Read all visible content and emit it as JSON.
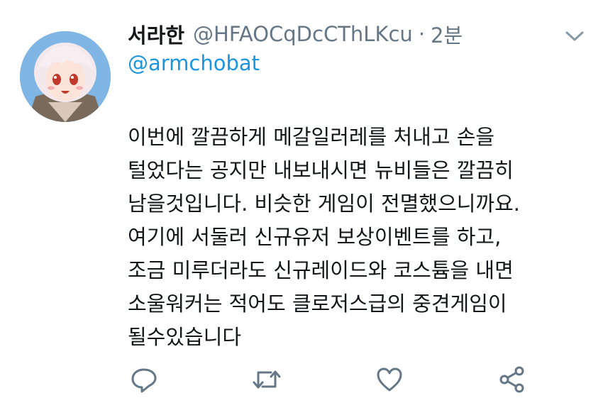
{
  "tweet": {
    "author_name": "서라한",
    "author_handle": "@HFAOCqDcCThLKcu",
    "separator": "·",
    "time": "2분",
    "reply_to": "@armchobat",
    "text_lines": [
      "이번에 깔끔하게 메갈일러레를 처내고 손을",
      "털었다는 공지만 내보내시면 뉴비들은 깔끔히",
      "남을것입니다. 비슷한 게임이 전멸했으니까요.",
      "여기에 서둘러 신규유저 보상이벤트를 하고,",
      "조금 미루더라도 신규레이드와 코스튬을 내면",
      "소울워커는 적어도 클로저스급의 중견게임이",
      "될수있습니다"
    ]
  },
  "icons": {
    "avatar": "avatar-anime-character",
    "menu": "chevron-down-icon",
    "reply": "reply-icon",
    "retweet": "retweet-icon",
    "like": "heart-icon",
    "share": "share-icon"
  },
  "colors": {
    "name": "#14171a",
    "meta": "#657786",
    "link": "#1b95e0",
    "icon": "#657786",
    "background": "#ffffff"
  }
}
